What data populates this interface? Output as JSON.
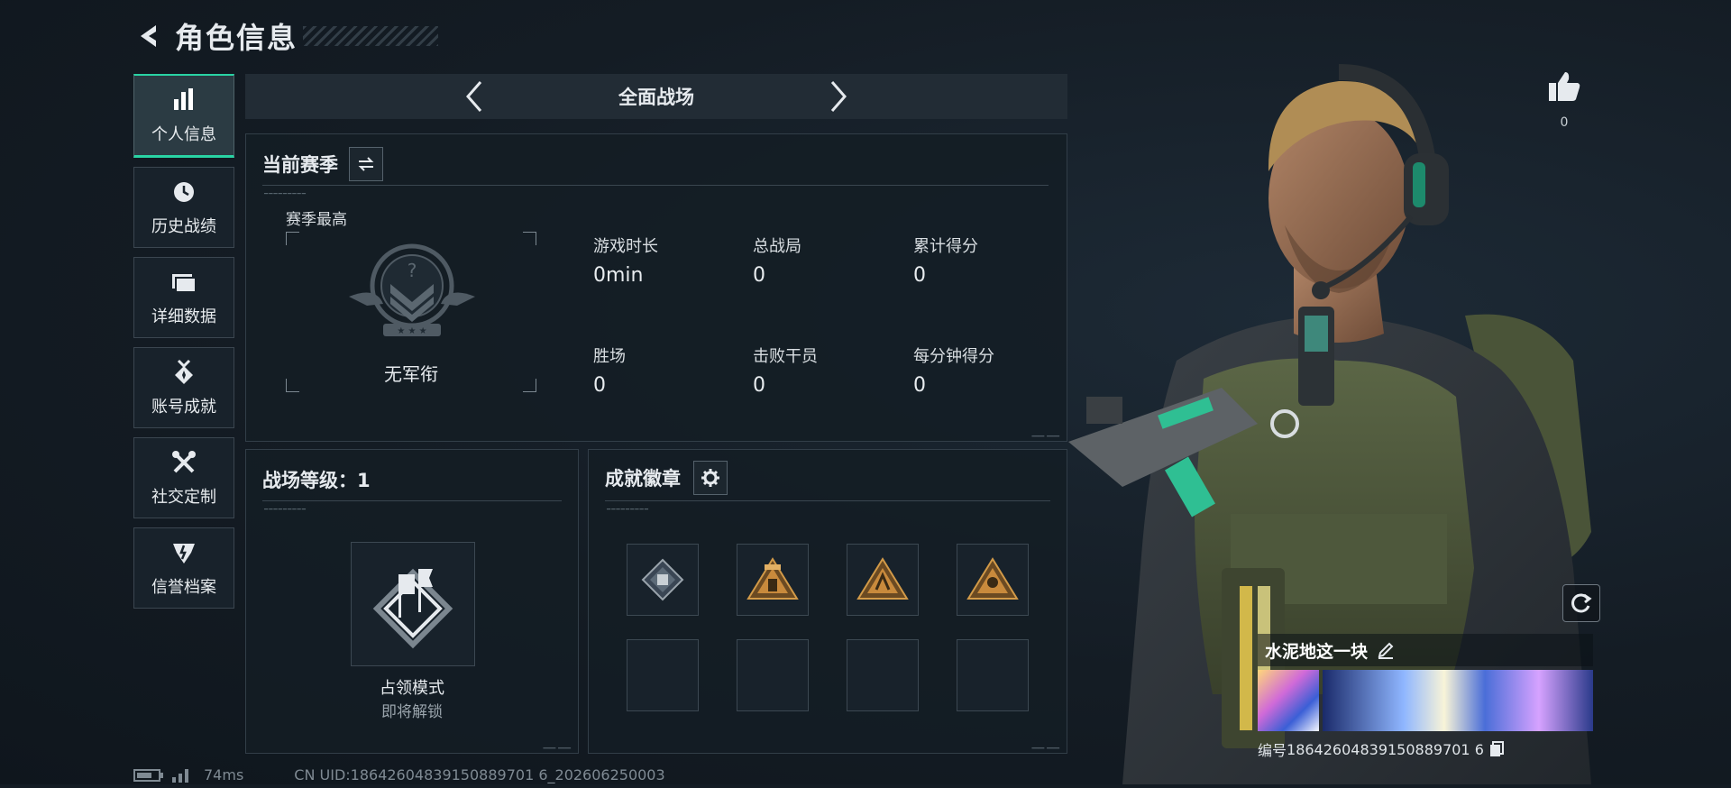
{
  "header": {
    "title": "角色信息"
  },
  "nav": {
    "items": [
      {
        "label": "个人信息",
        "icon": "bar-chart-icon",
        "active": true
      },
      {
        "label": "历史战绩",
        "icon": "clock-icon"
      },
      {
        "label": "详细数据",
        "icon": "folder-icon"
      },
      {
        "label": "账号成就",
        "icon": "medal-icon"
      },
      {
        "label": "社交定制",
        "icon": "wrench-icon"
      },
      {
        "label": "信誉档案",
        "icon": "shield-icon"
      }
    ]
  },
  "mode_selector": {
    "current": "全面战场"
  },
  "season": {
    "title": "当前赛季",
    "best_label": "赛季最高",
    "rank_name": "无军衔",
    "stats": [
      {
        "label": "游戏时长",
        "value": "0min"
      },
      {
        "label": "总战局",
        "value": "0"
      },
      {
        "label": "累计得分",
        "value": "0"
      },
      {
        "label": "胜场",
        "value": "0"
      },
      {
        "label": "击败干员",
        "value": "0"
      },
      {
        "label": "每分钟得分",
        "value": "0"
      }
    ]
  },
  "battlefield_level": {
    "title": "战场等级：1",
    "mode_name": "占领模式",
    "mode_status": "即将解锁"
  },
  "achievements": {
    "title": "成就徽章",
    "slots_filled": 4,
    "slots_total": 8
  },
  "character": {
    "name": "水泥地这一块",
    "id_label": "编号",
    "id_value": "18642604839150889701 6"
  },
  "likes": {
    "count": "0"
  },
  "footer": {
    "ping": "74ms",
    "uid": "CN UID:18642604839150889701 6_202606250003"
  },
  "colors": {
    "accent": "#29d3a4",
    "background": "#141c24",
    "panel_border": "#323e48"
  }
}
